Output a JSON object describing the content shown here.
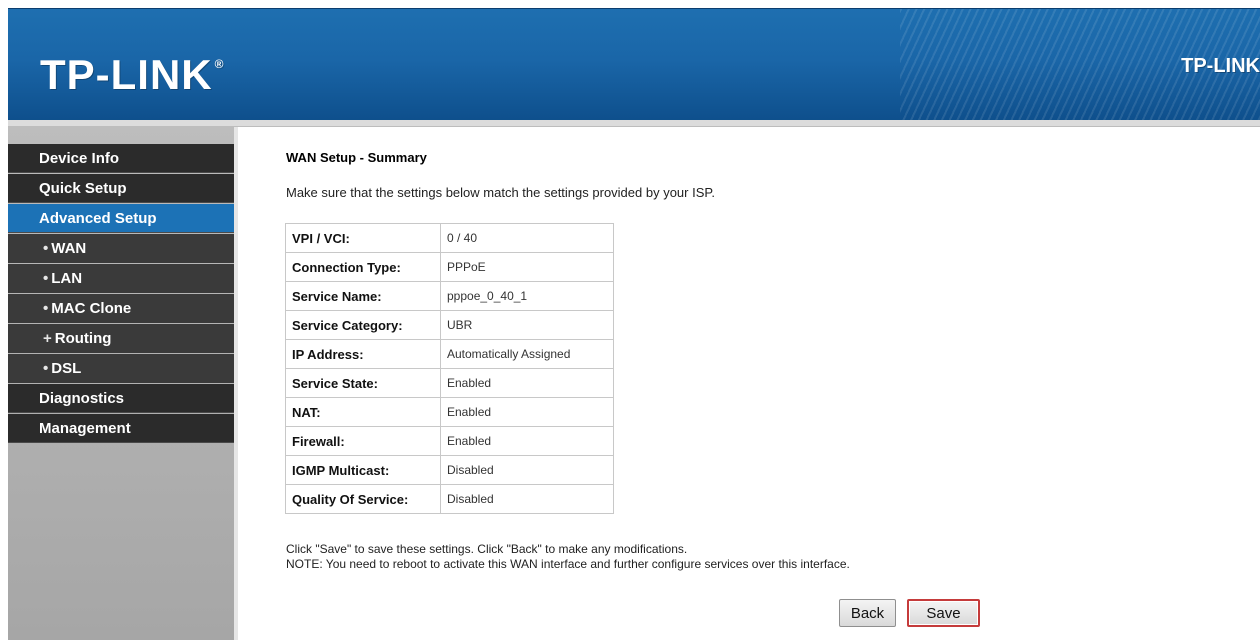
{
  "header": {
    "logo_text": "TP-LINK",
    "logo_mark": "®",
    "brand_right": "TP-LINK"
  },
  "sidebar": {
    "items": [
      {
        "label": "Device Info"
      },
      {
        "label": "Quick Setup"
      },
      {
        "label": "Advanced Setup",
        "active": true
      },
      {
        "label": "WAN",
        "sub": true
      },
      {
        "label": "LAN",
        "sub": true
      },
      {
        "label": "MAC Clone",
        "sub": true
      },
      {
        "label": "Routing",
        "sub": true
      },
      {
        "label": "DSL",
        "sub": true
      },
      {
        "label": "Diagnostics"
      },
      {
        "label": "Management"
      }
    ]
  },
  "main": {
    "title": "WAN Setup - Summary",
    "intro": "Make sure that the settings below match the settings provided by your ISP.",
    "rows": [
      {
        "key": "VPI / VCI:",
        "value": "0 / 40"
      },
      {
        "key": "Connection Type:",
        "value": "PPPoE"
      },
      {
        "key": "Service Name:",
        "value": "pppoe_0_40_1"
      },
      {
        "key": "Service Category:",
        "value": "UBR"
      },
      {
        "key": "IP Address:",
        "value": "Automatically Assigned"
      },
      {
        "key": "Service State:",
        "value": "Enabled"
      },
      {
        "key": "NAT:",
        "value": "Enabled"
      },
      {
        "key": "Firewall:",
        "value": "Enabled"
      },
      {
        "key": "IGMP Multicast:",
        "value": "Disabled"
      },
      {
        "key": "Quality Of Service:",
        "value": "Disabled"
      }
    ],
    "note_line1": "Click \"Save\" to save these settings. Click \"Back\" to make any modifications.",
    "note_line2": "NOTE: You need to reboot to activate this WAN interface and further configure services over this interface.",
    "back_label": "Back",
    "save_label": "Save"
  },
  "colors": {
    "header_blue": "#1a66a8",
    "active_nav": "#1c72b6",
    "nav_dark": "#2b2b2b",
    "save_border": "#c53b3b"
  }
}
